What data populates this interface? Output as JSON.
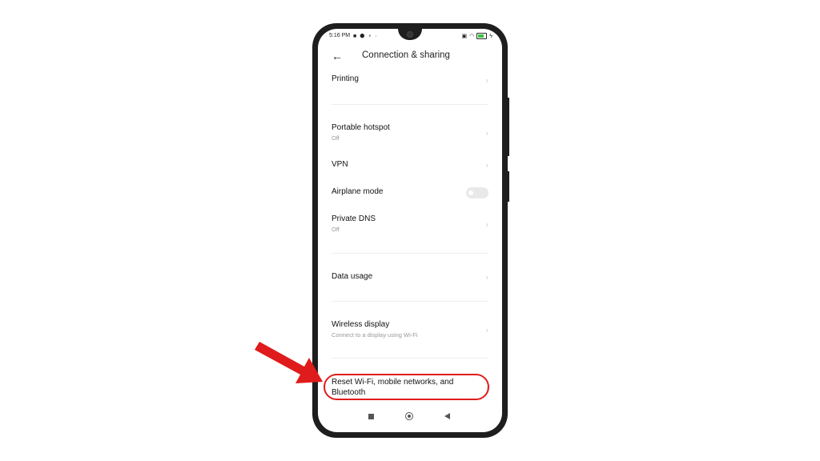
{
  "status_bar": {
    "time": "5:16 PM",
    "left_icons": [
      "video-icon",
      "shield-icon",
      "location-icon",
      "dot-icon"
    ],
    "right_icons": [
      "sim-icon",
      "wifi-icon",
      "battery-icon",
      "charging-icon"
    ]
  },
  "header": {
    "back_icon": "←",
    "title": "Connection & sharing"
  },
  "items": [
    {
      "label": "Printing",
      "sub": null,
      "control": "chevron"
    },
    {
      "label": "Portable hotspot",
      "sub": "Off",
      "control": "chevron"
    },
    {
      "label": "VPN",
      "sub": null,
      "control": "chevron"
    },
    {
      "label": "Airplane mode",
      "sub": null,
      "control": "toggle",
      "toggle_on": false
    },
    {
      "label": "Private DNS",
      "sub": "Off",
      "control": "chevron"
    },
    {
      "label": "Data usage",
      "sub": null,
      "control": "chevron"
    },
    {
      "label": "Wireless display",
      "sub": "Connect to a display using Wi-Fi",
      "control": "chevron"
    },
    {
      "label": "Reset Wi-Fi, mobile networks, and Bluetooth",
      "sub": null,
      "control": "chevron"
    }
  ],
  "chevron": "›",
  "annotation": {
    "color": "#e01b1b",
    "target": "Reset Wi-Fi, mobile networks, and Bluetooth"
  },
  "nav_bar": [
    "recents-button",
    "home-button",
    "back-button"
  ]
}
